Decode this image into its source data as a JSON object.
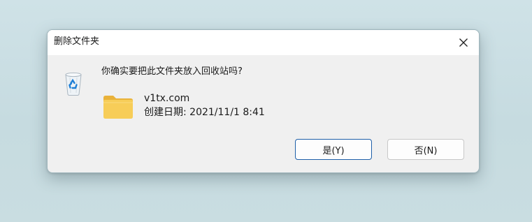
{
  "dialog": {
    "title": "删除文件夹",
    "question": "你确实要把此文件夹放入回收站吗?",
    "item": {
      "name": "v1tx.com",
      "date_label": "创建日期: 2021/11/1 8:41"
    },
    "buttons": {
      "yes_label": "是(Y)",
      "no_label": "否(N)"
    },
    "icons": {
      "close": "close-icon",
      "question": "recycle-bin-icon",
      "item": "folder-icon"
    }
  },
  "colors": {
    "primary_border": "#1e5fa8",
    "folder": "#f3c44b",
    "recycle": "#1e7fd6"
  }
}
